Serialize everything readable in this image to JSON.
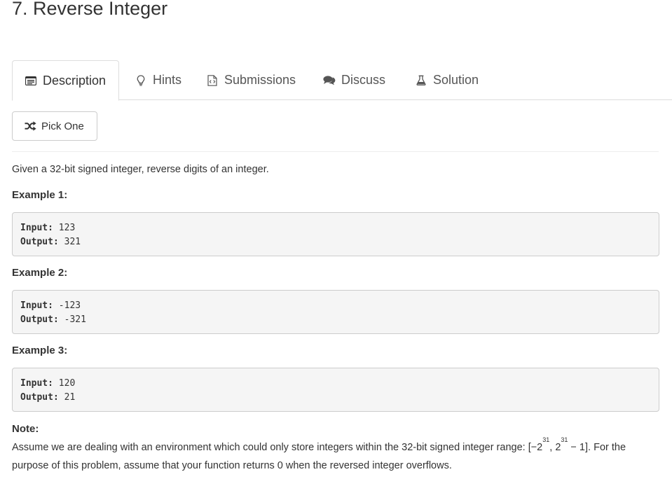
{
  "problem": {
    "title": "7. Reverse Integer"
  },
  "tabs": [
    {
      "label": "Description",
      "icon": "list-alt-icon",
      "active": true
    },
    {
      "label": "Hints",
      "icon": "lightbulb-icon",
      "active": false
    },
    {
      "label": "Submissions",
      "icon": "file-code-icon",
      "active": false
    },
    {
      "label": "Discuss",
      "icon": "comments-icon",
      "active": false
    },
    {
      "label": "Solution",
      "icon": "flask-icon",
      "active": false
    }
  ],
  "pick_button": {
    "label": "Pick One",
    "icon": "random-icon"
  },
  "description": {
    "intro": "Given a 32-bit signed integer, reverse digits of an integer."
  },
  "examples": [
    {
      "heading": "Example 1:",
      "input_label": "Input:",
      "input": " 123",
      "output_label": "Output:",
      "output": " 321"
    },
    {
      "heading": "Example 2:",
      "input_label": "Input:",
      "input": " -123",
      "output_label": "Output:",
      "output": " -321"
    },
    {
      "heading": "Example 3:",
      "input_label": "Input:",
      "input": " 120",
      "output_label": "Output:",
      "output": " 21"
    }
  ],
  "note": {
    "heading": "Note:",
    "line1_a": "Assume we are dealing with an environment which could only store integers within the 32-bit signed integer range: [−2",
    "exp1": "31",
    "line1_b": ",  2",
    "exp2": "31",
    "line1_c": " − 1]. For the",
    "line2": "purpose of this problem, assume that your function returns 0 when the reversed integer overflows."
  }
}
